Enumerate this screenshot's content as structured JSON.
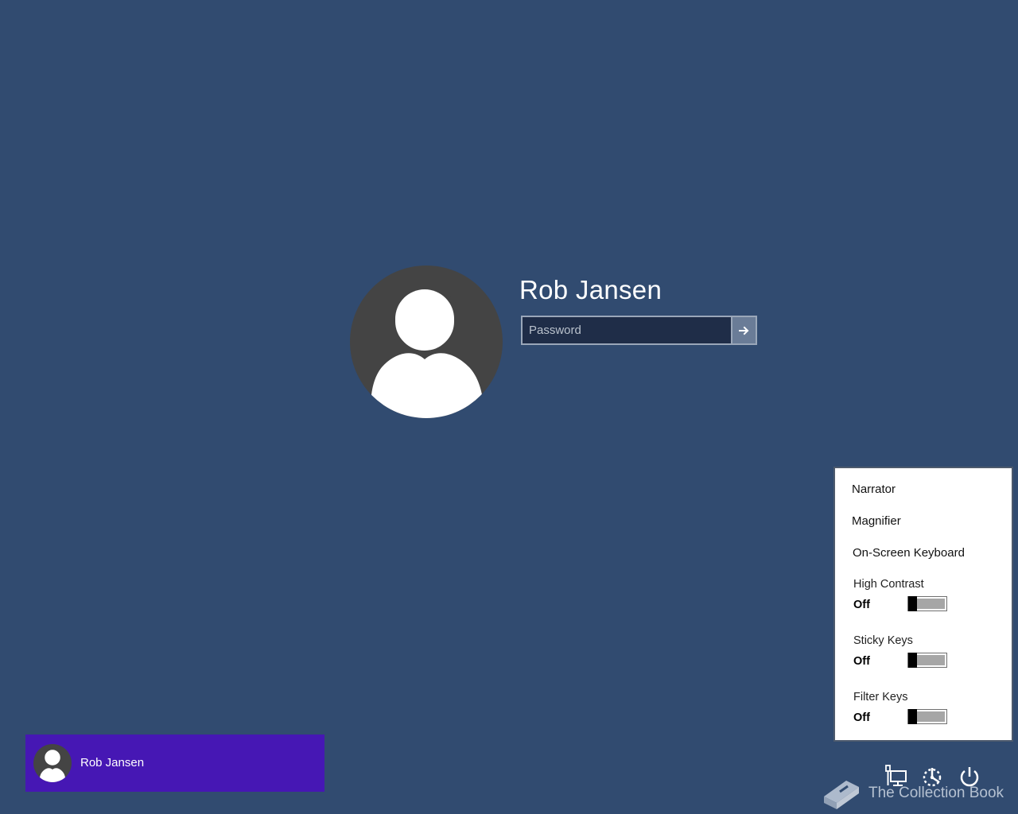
{
  "login": {
    "user_name": "Rob Jansen",
    "password_placeholder": "Password",
    "submit_icon": "arrow-right-icon"
  },
  "ease_of_access": {
    "items": [
      {
        "label": "Narrator"
      },
      {
        "label": "Magnifier"
      },
      {
        "label": "On-Screen Keyboard"
      }
    ],
    "toggles": [
      {
        "label": "High Contrast",
        "state": "Off"
      },
      {
        "label": "Sticky Keys",
        "state": "Off"
      },
      {
        "label": "Filter Keys",
        "state": "Off"
      }
    ]
  },
  "user_tile": {
    "name": "Rob Jansen"
  },
  "system_icons": [
    "network-icon",
    "ease-of-access-icon",
    "power-icon"
  ],
  "watermark": {
    "text": "The Collection Book"
  },
  "colors": {
    "background": "#314b70",
    "user_tile": "#4617b4",
    "avatar": "#444444"
  }
}
